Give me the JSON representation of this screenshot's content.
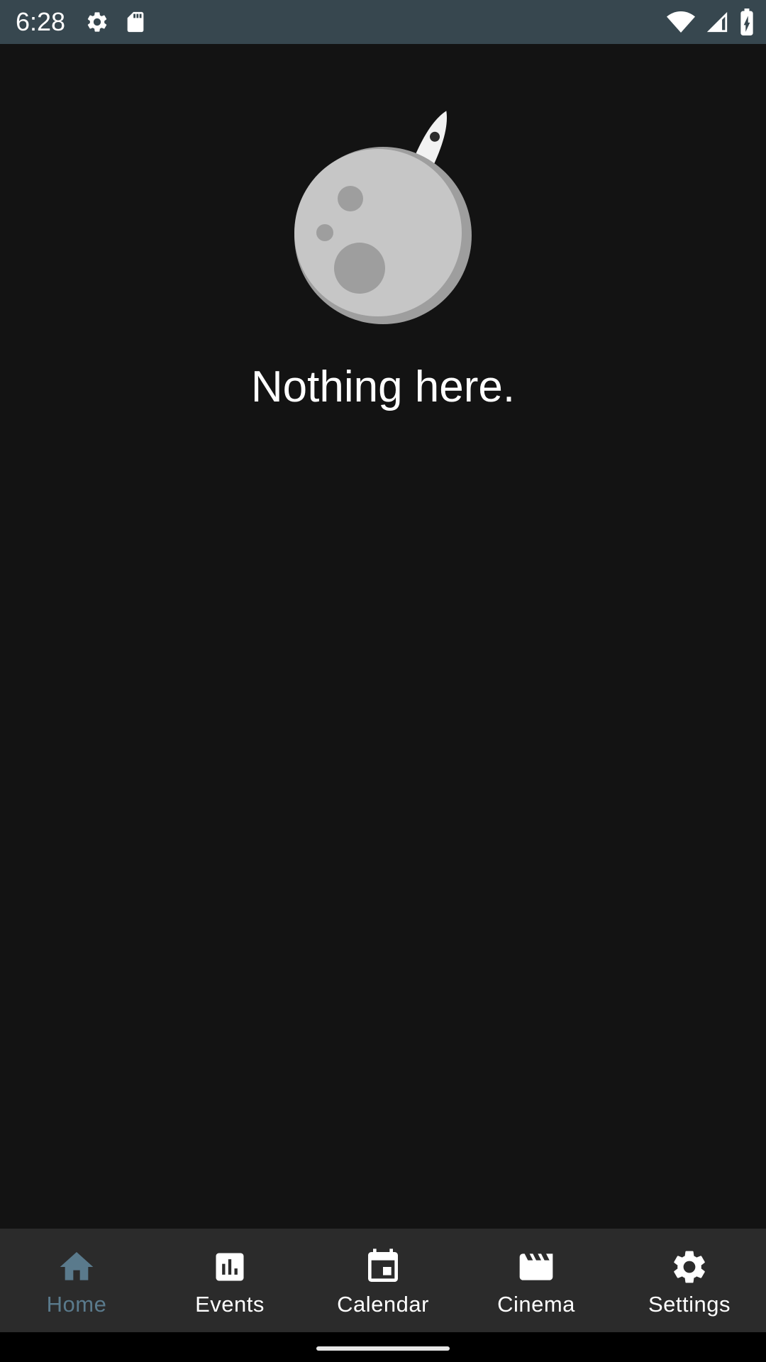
{
  "status_bar": {
    "time": "6:28",
    "left_icons": [
      "settings-icon",
      "sd-card-icon"
    ],
    "right_icons": [
      "wifi-icon",
      "cell-signal-icon",
      "battery-charging-icon"
    ],
    "background": "#37474f"
  },
  "empty_state": {
    "illustration": "moon-rocket-illustration",
    "message": "Nothing here."
  },
  "bottom_nav": {
    "active_color": "#5a7a8c",
    "items": [
      {
        "label": "Home",
        "icon": "home-icon",
        "active": true
      },
      {
        "label": "Events",
        "icon": "bar-chart-icon",
        "active": false
      },
      {
        "label": "Calendar",
        "icon": "calendar-icon",
        "active": false
      },
      {
        "label": "Cinema",
        "icon": "clapperboard-icon",
        "active": false
      },
      {
        "label": "Settings",
        "icon": "settings-icon",
        "active": false
      }
    ]
  }
}
